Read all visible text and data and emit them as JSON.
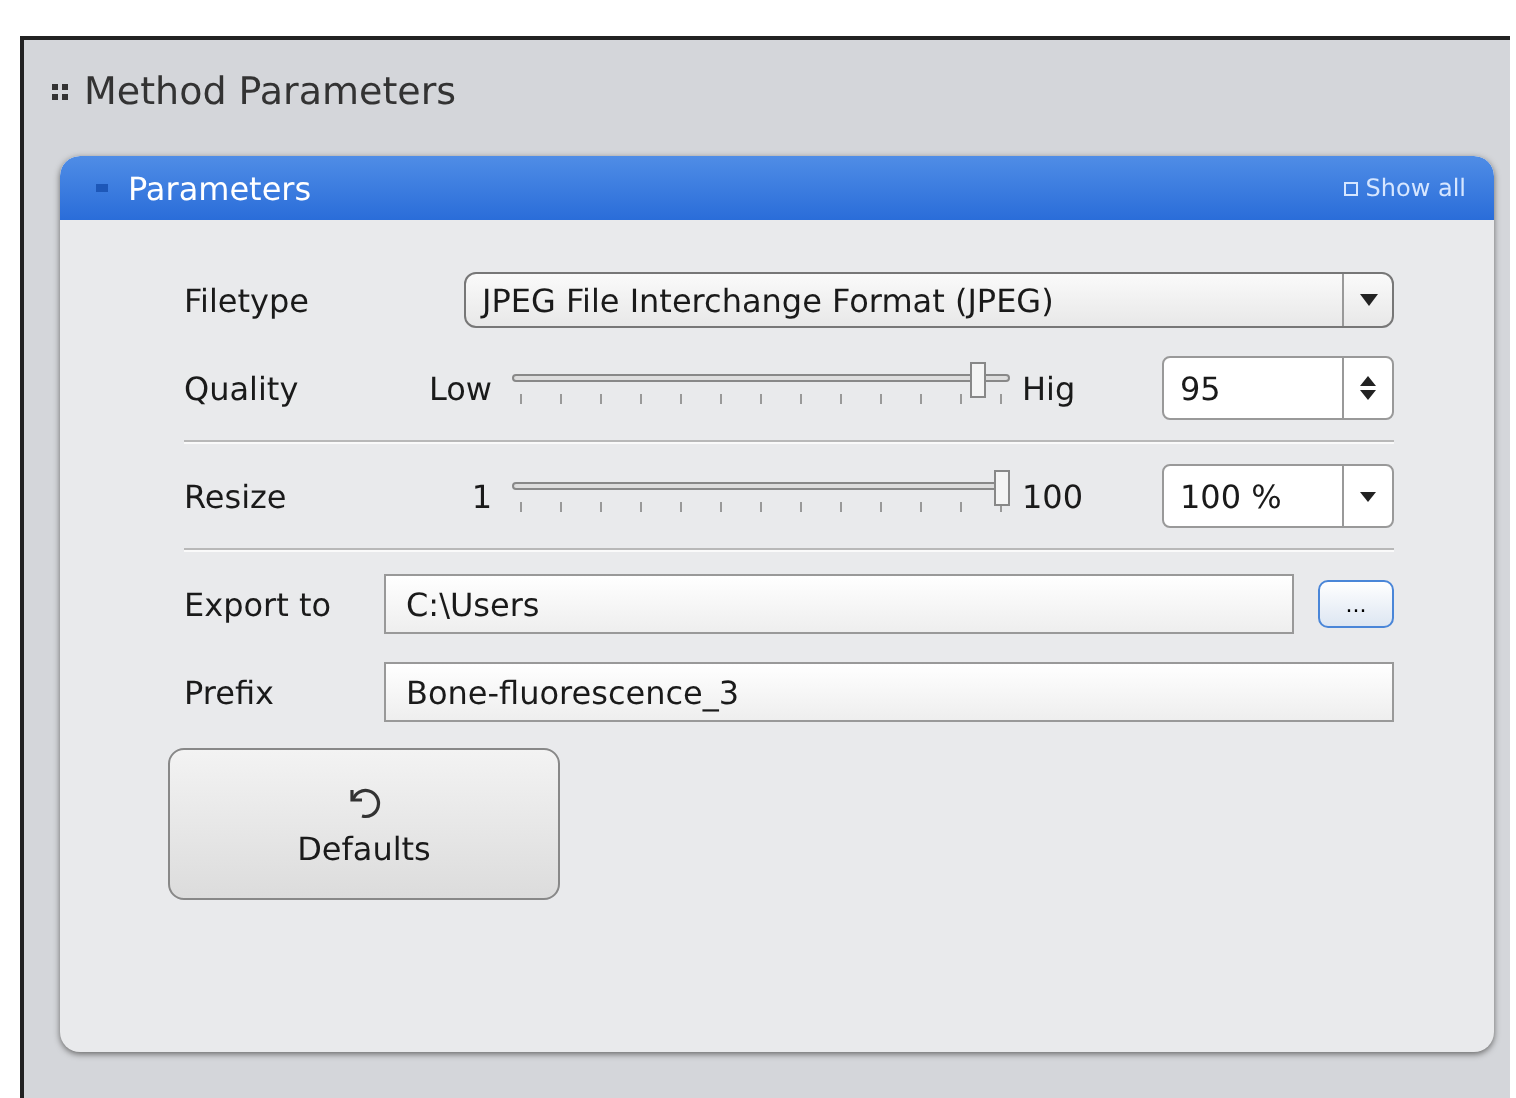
{
  "section": {
    "title": "Method Parameters"
  },
  "panel": {
    "title": "Parameters",
    "show_all": "Show all"
  },
  "filetype": {
    "label": "Filetype",
    "value": "JPEG File Interchange Format (JPEG)"
  },
  "quality": {
    "label": "Quality",
    "min_label": "Low",
    "max_label": "Hig",
    "level": 0.95,
    "value": "95"
  },
  "resize": {
    "label": "Resize",
    "min_label": "1",
    "max_label": "100",
    "level": 1.0,
    "value": "100 %"
  },
  "export_to": {
    "label": "Export to",
    "value": "C:\\Users",
    "browse": "..."
  },
  "prefix": {
    "label": "Prefix",
    "value": "Bone-fluorescence_3"
  },
  "defaults_button": {
    "label": "Defaults"
  }
}
